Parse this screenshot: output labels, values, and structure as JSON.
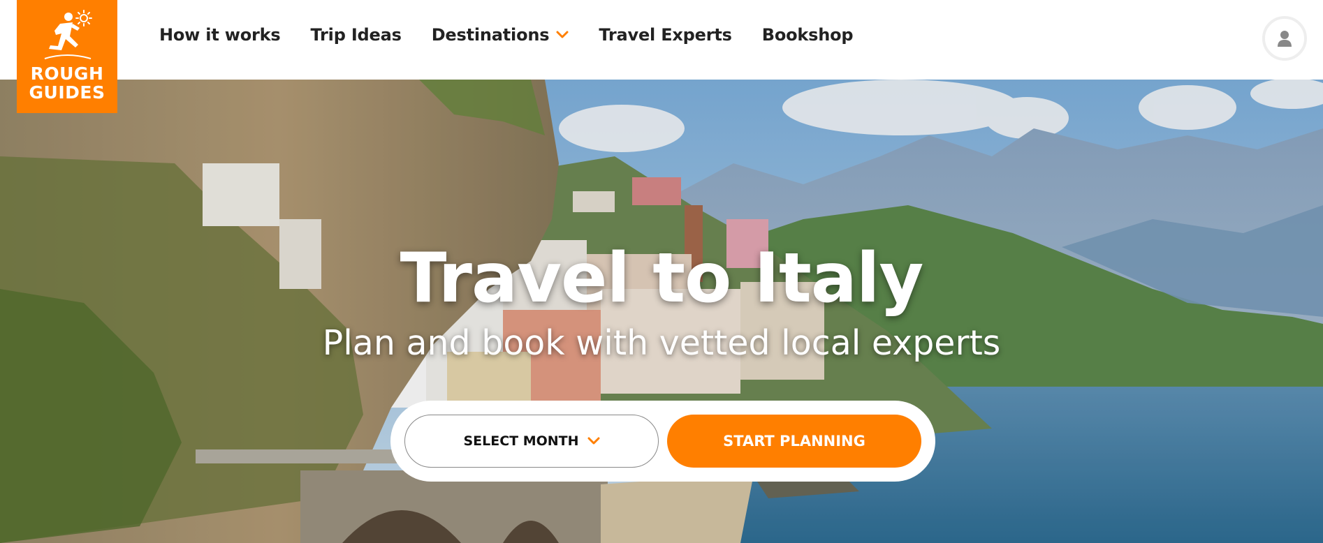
{
  "brand": {
    "logo_line1": "ROUGH",
    "logo_line2": "GUIDES",
    "accent": "#ff7f00"
  },
  "nav": {
    "items": [
      {
        "label": "How it works"
      },
      {
        "label": "Trip Ideas"
      },
      {
        "label": "Destinations",
        "has_dropdown": true
      },
      {
        "label": "Travel Experts"
      },
      {
        "label": "Bookshop"
      }
    ],
    "account_icon": "user-icon"
  },
  "hero": {
    "title": "Travel to Italy",
    "subtitle": "Plan and book with vetted local experts",
    "select_month_label": "SELECT MONTH",
    "cta_label": "START PLANNING"
  }
}
